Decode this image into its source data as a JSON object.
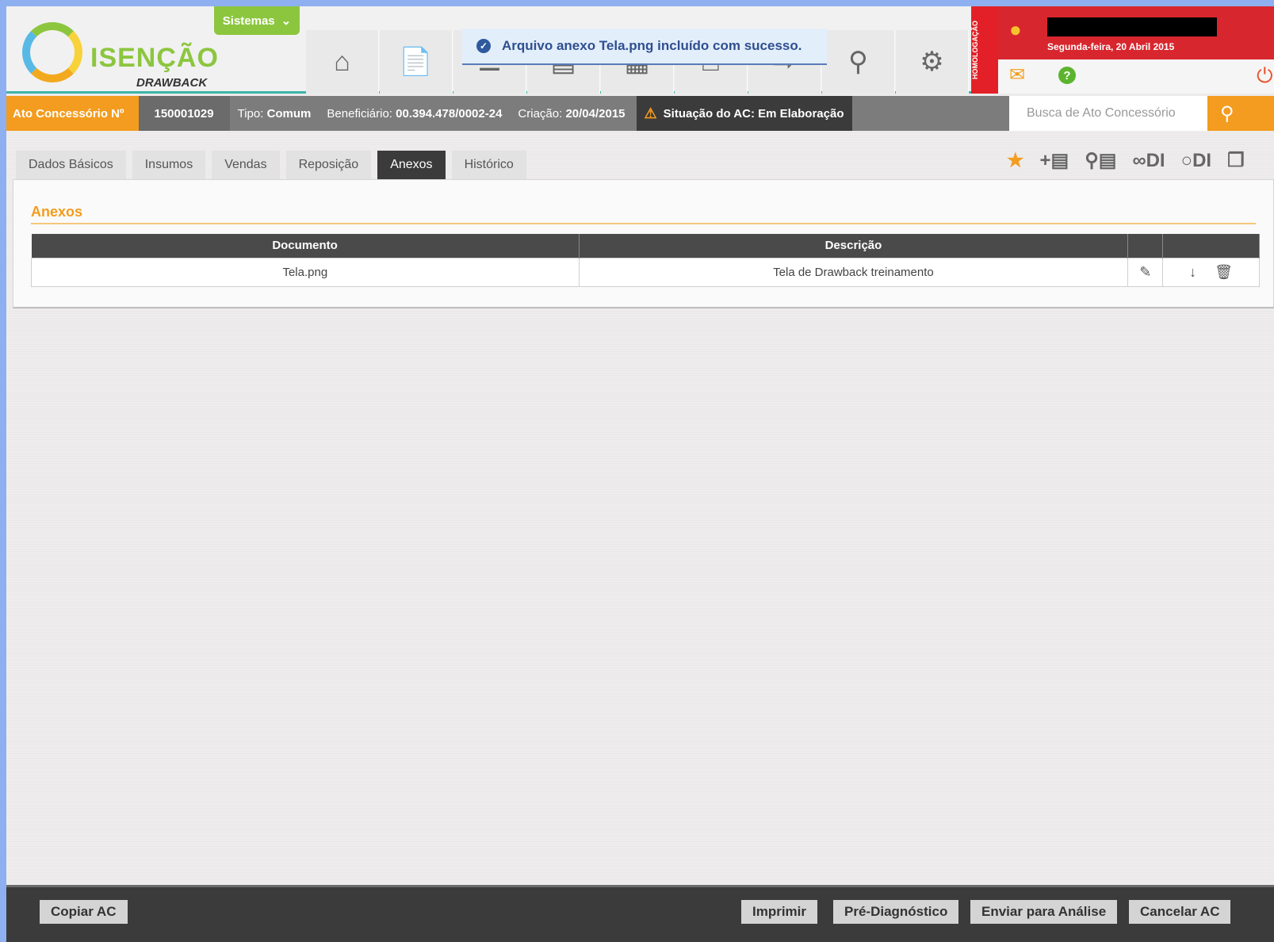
{
  "header": {
    "logo_name": "ISENÇÃO",
    "logo_sub": "DRAWBACK",
    "sistemas_label": "Sistemas",
    "nav_icons": [
      "home-icon",
      "ac-new-icon",
      "ac-list-icon",
      "document-icon",
      "report-icon",
      "export-icon",
      "ac-transfer-icon",
      "search-plus-icon",
      "user-settings-icon"
    ],
    "toast": "Arquivo anexo Tela.png incluído com sucesso.",
    "user": {
      "environment_tag": "HOMOLOGAÇÃO",
      "date": "Segunda-feira, 20 Abril 2015",
      "help_label": "?"
    }
  },
  "infobar": {
    "ato_label": "Ato Concessório Nº",
    "ato_number": "150001029",
    "tipo_label": "Tipo:",
    "tipo_value": "Comum",
    "beneficiario_label": "Beneficiário:",
    "beneficiario_value": "00.394.478/0002-24",
    "criacao_label": "Criação:",
    "criacao_value": "20/04/2015",
    "situacao": "Situação do AC: Em Elaboração",
    "search_placeholder": "Busca de Ato Concessório"
  },
  "tabs": [
    {
      "label": "Dados Básicos",
      "active": false
    },
    {
      "label": "Insumos",
      "active": false
    },
    {
      "label": "Vendas",
      "active": false
    },
    {
      "label": "Reposição",
      "active": false
    },
    {
      "label": "Anexos",
      "active": true
    },
    {
      "label": "Histórico",
      "active": false
    }
  ],
  "toolbar": {
    "icons": [
      "favorite-star-icon",
      "add-nf-icon",
      "search-nf-icon",
      "link-di-icon",
      "unlink-di-icon",
      "copy-icon"
    ],
    "di_label": "DI"
  },
  "anexos": {
    "title": "Anexos",
    "columns": [
      "Documento",
      "Descrição"
    ],
    "rows": [
      {
        "documento": "Tela.png",
        "descricao": "Tela de Drawback treinamento"
      }
    ]
  },
  "footer": {
    "copiar": "Copiar AC",
    "imprimir": "Imprimir",
    "pre_diagnostico": "Pré-Diagnóstico",
    "enviar": "Enviar para Análise",
    "cancelar": "Cancelar AC"
  },
  "colors": {
    "accent_orange": "#f39c1f",
    "brand_green": "#8cc63f",
    "alert_red": "#d8262e",
    "dark_bar": "#3b3b3b"
  }
}
